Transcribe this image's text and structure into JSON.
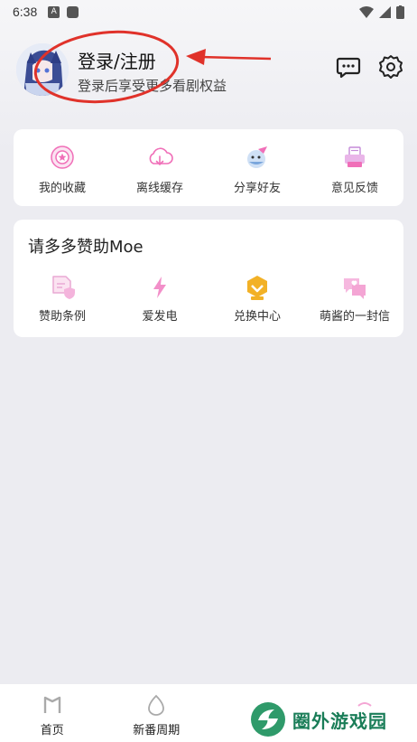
{
  "status_bar": {
    "time": "6:38",
    "a_icon": "A"
  },
  "header": {
    "login_title": "登录/注册",
    "login_subtitle": "登录后享受更多看剧权益"
  },
  "quick_actions": [
    {
      "label": "我的收藏",
      "icon": "favorites-icon"
    },
    {
      "label": "离线缓存",
      "icon": "cloud-download-icon"
    },
    {
      "label": "分享好友",
      "icon": "share-icon"
    },
    {
      "label": "意见反馈",
      "icon": "feedback-icon"
    }
  ],
  "sponsor": {
    "title": "请多多赞助Moe",
    "items": [
      {
        "label": "赞助条例",
        "icon": "document-shield-icon"
      },
      {
        "label": "爱发电",
        "icon": "lightning-icon"
      },
      {
        "label": "兑换中心",
        "icon": "badge-icon"
      },
      {
        "label": "萌酱的一封信",
        "icon": "letter-icon"
      }
    ]
  },
  "bottom_nav": [
    {
      "label": "首页",
      "icon": "home-icon"
    },
    {
      "label": "新番周期",
      "icon": "egg-icon"
    }
  ],
  "watermark": {
    "text": "圈外游戏园"
  },
  "colors": {
    "accent": "#f06fb8",
    "annotation": "#e0322a",
    "badge": "#f2b126"
  }
}
